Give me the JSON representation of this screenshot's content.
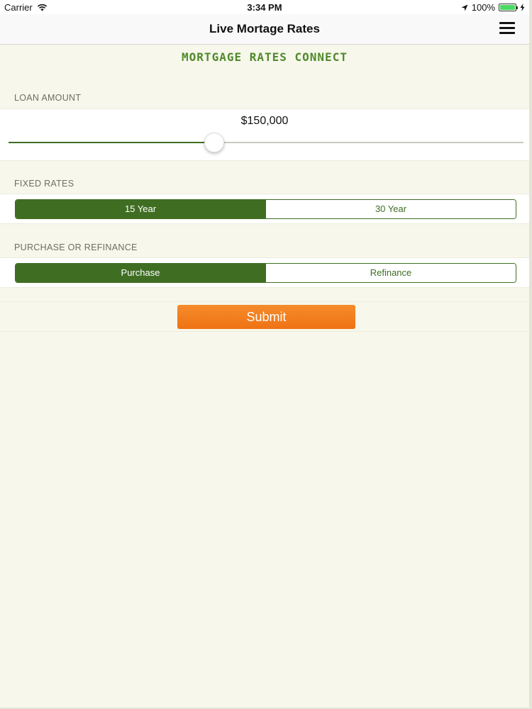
{
  "status_bar": {
    "carrier": "Carrier",
    "time": "3:34 PM",
    "battery": "100%"
  },
  "nav": {
    "title": "Live Mortage Rates",
    "menu_icon": "hamburger-menu-icon"
  },
  "brand": {
    "text": "MORTGAGE RATES CONNECT",
    "color": "#4f8a2b"
  },
  "loan_amount": {
    "label": "LOAN AMOUNT",
    "value": "$150,000",
    "slider_fraction": 0.4
  },
  "fixed_rates": {
    "label": "FIXED RATES",
    "options": [
      "15 Year",
      "30 Year"
    ],
    "selected": "15 Year"
  },
  "purchase_refinance": {
    "label": "PURCHASE OR REFINANCE",
    "options": [
      "Purchase",
      "Refinance"
    ],
    "selected": "Purchase"
  },
  "submit": {
    "label": "Submit",
    "color": "#f07a1a"
  },
  "colors": {
    "accent": "#3f6e23",
    "background": "#f7f7eb"
  }
}
